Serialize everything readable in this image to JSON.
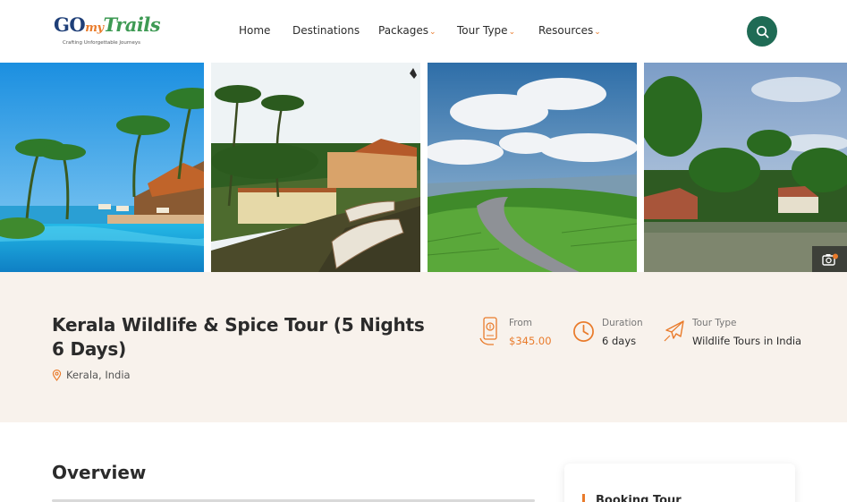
{
  "header": {
    "logo": {
      "go": "GO",
      "my": "my",
      "trails": "Trails",
      "tagline": "Crafting Unforgettable Journeys"
    },
    "nav": [
      {
        "label": "Home",
        "has_dropdown": false
      },
      {
        "label": "Destinations",
        "has_dropdown": false
      },
      {
        "label": "Packages",
        "has_dropdown": true
      },
      {
        "label": "Tour Type",
        "has_dropdown": true
      },
      {
        "label": "Resources",
        "has_dropdown": true
      }
    ],
    "search_icon": "search-icon"
  },
  "gallery": {
    "photos": [
      "beach-resort-pool",
      "backwater-houseboats",
      "tea-plantation-road",
      "lake-palm-village"
    ],
    "badge_count": "4",
    "camera_icon": "camera-icon"
  },
  "tour": {
    "title": "Kerala Wildlife & Spice Tour (5 Nights 6 Days)",
    "location": "Kerala, India",
    "stats": {
      "from_label": "From",
      "from_value": "$345.00",
      "duration_label": "Duration",
      "duration_value": "6 days",
      "type_label": "Tour Type",
      "type_value": "Wildlife Tours in India"
    }
  },
  "overview": {
    "title": "Overview"
  },
  "booking": {
    "title": "Booking Tour"
  },
  "colors": {
    "accent": "#e97b2b",
    "primary": "#1f6b55",
    "band": "#f8f2ec"
  }
}
